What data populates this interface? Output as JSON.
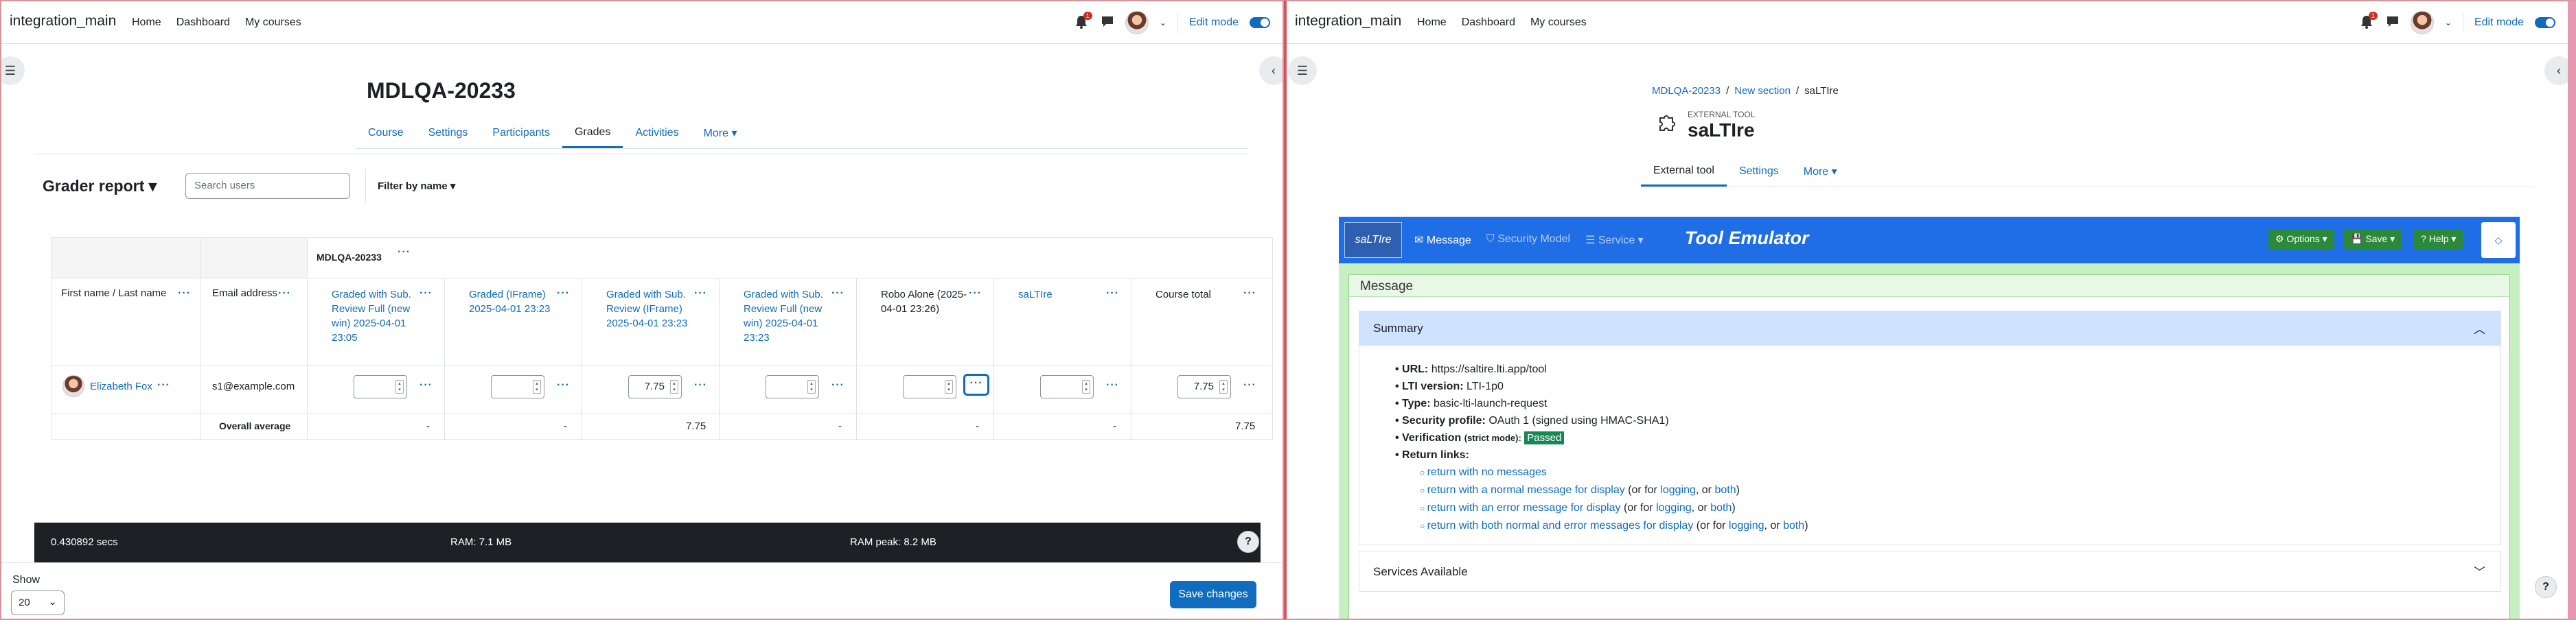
{
  "left": {
    "nav": {
      "brand": "integration_main",
      "links": [
        "Home",
        "Dashboard",
        "My courses"
      ],
      "badge": "1",
      "edit_mode": "Edit mode"
    },
    "course_title": "MDLQA-20233",
    "tabs": [
      "Course",
      "Settings",
      "Participants",
      "Grades",
      "Activities",
      "More ▾"
    ],
    "grader": {
      "title": "Grader report ▾",
      "search_placeholder": "Search users",
      "filter": "Filter by name ▾"
    },
    "table": {
      "category": "MDLQA-20233",
      "name_header": "First name / Last name",
      "email_header": "Email address",
      "columns": [
        {
          "label": "Graded with Sub. Review Full (new win) 2025-04-01 23:05",
          "value": ""
        },
        {
          "label": "Graded (IFrame) 2025-04-01 23:23",
          "value": ""
        },
        {
          "label": "Graded with Sub. Review (IFrame) 2025-04-01 23:23",
          "value": "7.75"
        },
        {
          "label": "Graded with Sub. Review Full (new win) 2025-04-01 23:23",
          "value": ""
        },
        {
          "label": "Robo Alone (2025-04-01 23:26)",
          "value": ""
        },
        {
          "label": "saLTIre",
          "value": ""
        },
        {
          "label": "Course total",
          "value": "7.75"
        }
      ],
      "student": {
        "name": "Elizabeth Fox",
        "email": "s1@example.com"
      },
      "overall_label": "Overall average",
      "overall": [
        "-",
        "-",
        "7.75",
        "-",
        "-",
        "-",
        "7.75"
      ]
    },
    "footer": {
      "secs": "0.430892 secs",
      "ram": "RAM: 7.1 MB",
      "ram_peak": "RAM peak: 8.2 MB"
    },
    "bottom": {
      "show_label": "Show",
      "show_value": "20",
      "save": "Save changes"
    }
  },
  "right": {
    "nav": {
      "brand": "integration_main",
      "links": [
        "Home",
        "Dashboard",
        "My courses"
      ],
      "badge": "1",
      "edit_mode": "Edit mode"
    },
    "breadcrumb": [
      "MDLQA-20233",
      "New section",
      "saLTIre"
    ],
    "kicker": "EXTERNAL TOOL",
    "title": "saLTIre",
    "tabs": [
      "External tool",
      "Settings",
      "More ▾"
    ],
    "tool": {
      "logo": "saLTIre",
      "menu": [
        "Message",
        "Security Model",
        "Service ▾"
      ],
      "emulator": "Tool Emulator",
      "buttons": [
        "Options",
        "Save",
        "Help"
      ],
      "message_header": "Message",
      "summary_header": "Summary",
      "url_label": "URL:",
      "url": "https://saltire.lti.app/tool",
      "ver_label": "LTI version:",
      "ver": "LTI-1p0",
      "type_label": "Type:",
      "type": "basic-lti-launch-request",
      "sec_label": "Security profile:",
      "sec": "OAuth 1 (signed using HMAC-SHA1)",
      "verif_label": "Verification",
      "verif_mode": "(strict mode):",
      "verif": "Passed",
      "return_label": "Return links:",
      "links": [
        {
          "a": "return with no messages",
          "b": "",
          "c": "",
          "d": "",
          "e": "",
          "f": ""
        },
        {
          "a": "return with a normal message for display",
          "b": " (or for ",
          "c": "logging",
          "d": ", or ",
          "e": "both",
          "f": ")"
        },
        {
          "a": "return with an error message for display",
          "b": " (or for ",
          "c": "logging",
          "d": ", or ",
          "e": "both",
          "f": ")"
        },
        {
          "a": "return with both normal and error messages for display",
          "b": " (or for ",
          "c": "logging",
          "d": ", or ",
          "e": "both",
          "f": ")"
        }
      ],
      "services": "Services Available"
    }
  }
}
